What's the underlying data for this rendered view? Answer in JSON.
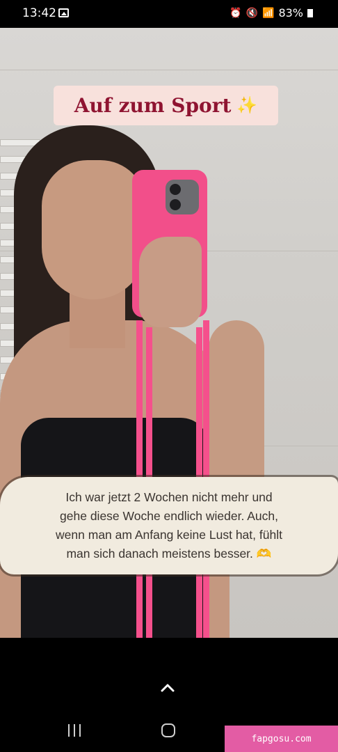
{
  "status_bar": {
    "time": "13:42",
    "battery": "83%"
  },
  "story": {
    "title": "Auf zum Sport",
    "title_emoji": "✨",
    "caption": "Ich war jetzt 2 Wochen nicht mehr und\ngehe diese Woche endlich wieder. Auch,\nwenn man am Anfang keine Lust hat, fühlt\nman sich danach meistens besser. 🫶"
  },
  "watermark": "fapgosu.com",
  "colors": {
    "title_text": "#8f1431",
    "title_bg": "#f8e1dc",
    "phone_case": "#f24f8a",
    "watermark_bg": "#e35ca4"
  }
}
